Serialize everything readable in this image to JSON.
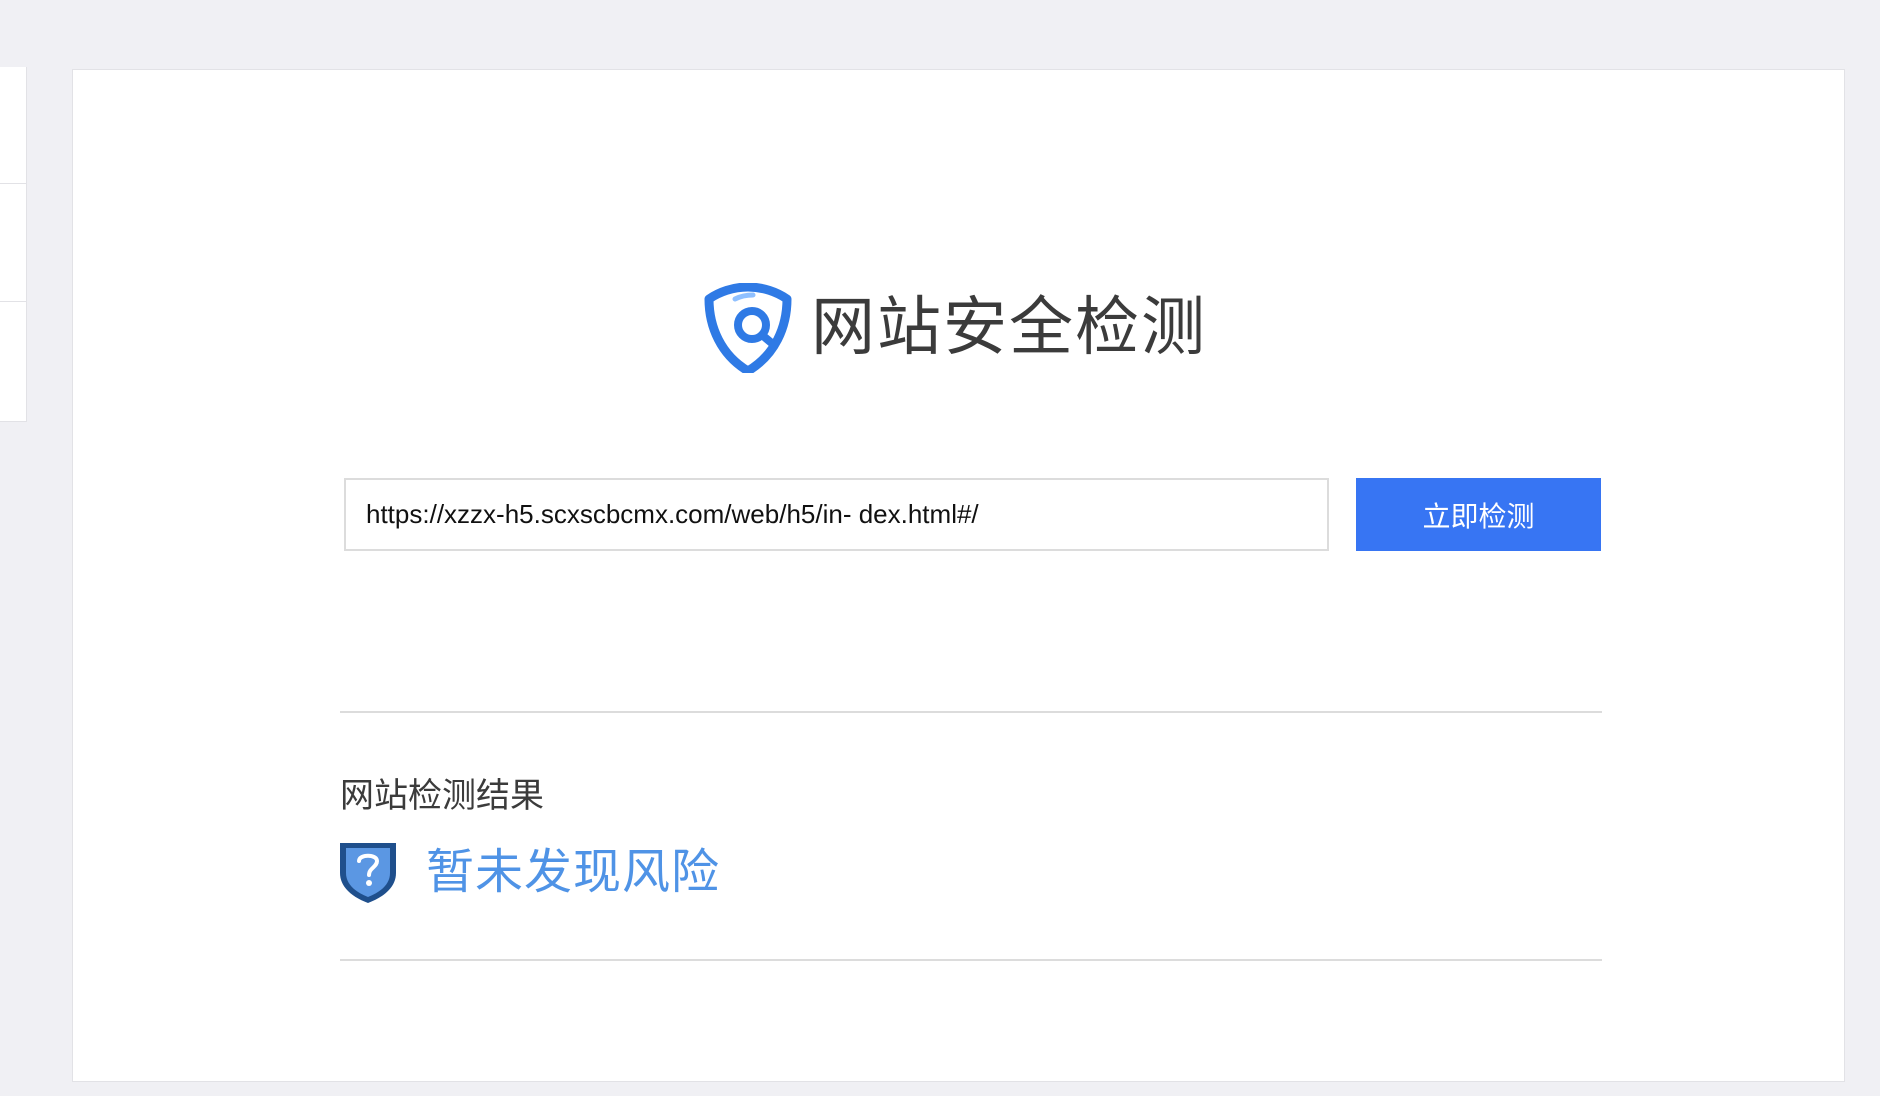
{
  "header": {
    "title": "网站安全检测",
    "logo_icon": "shield-search-icon"
  },
  "search": {
    "url_value": "https://xzzx-h5.scxscbcmx.com/web/h5/in- dex.html#/",
    "button_label": "立即检测"
  },
  "result": {
    "heading": "网站检测结果",
    "status_text": "暂未发现风险",
    "status_icon": "shield-question-icon"
  },
  "colors": {
    "page_background": "#f0f0f4",
    "primary_blue": "#3775f3",
    "result_blue": "#4f93e6",
    "text_dark": "#3b3b3b",
    "logo_blue": "#2f7ae5",
    "divider": "#dcdcdc"
  }
}
